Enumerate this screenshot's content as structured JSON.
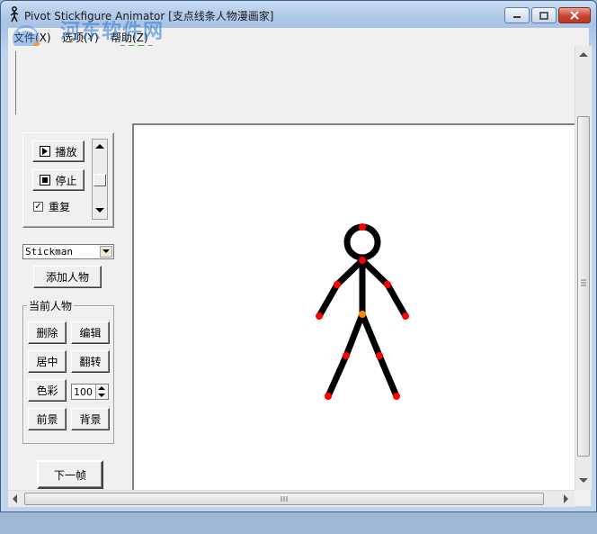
{
  "window": {
    "title": "Pivot Stickfigure Animator [支点线条人物漫画家]"
  },
  "menu": {
    "items": [
      "文件(X)",
      "选项(Y)",
      "帮助(Z)"
    ]
  },
  "watermark": {
    "site_name": "河东软件网",
    "url": "www.pc0359.cn"
  },
  "playback": {
    "play_label": "播放",
    "stop_label": "停止",
    "loop_label": "重复",
    "loop_checked": true
  },
  "figure_select": {
    "value": "Stickman"
  },
  "add_figure_label": "添加人物",
  "current_figure": {
    "group_label": "当前人物",
    "delete_label": "删除",
    "edit_label": "编辑",
    "center_label": "居中",
    "flip_label": "翻转",
    "color_label": "色彩",
    "size_value": "100",
    "front_label": "前景",
    "back_label": "背景"
  },
  "next_frame_label": "下一帧",
  "colors": {
    "joint": "#ff0000",
    "center_joint": "#ff8800",
    "limb": "#000000"
  }
}
